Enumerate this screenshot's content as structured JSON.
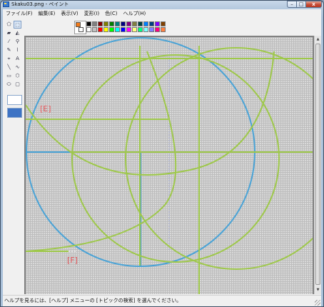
{
  "window": {
    "title": "Skaku03.png - ペイント",
    "minimize_label": "–",
    "maximize_label": "□",
    "close_label": "x"
  },
  "menu": {
    "items": [
      {
        "label": "ファイル(F)"
      },
      {
        "label": "編集(E)"
      },
      {
        "label": "表示(V)"
      },
      {
        "label": "変形(I)"
      },
      {
        "label": "色(C)"
      },
      {
        "label": "ヘルプ(H)"
      }
    ]
  },
  "toolbox": {
    "tools": [
      {
        "name": "free-form-select-icon",
        "glyph": "⬠"
      },
      {
        "name": "rect-select-icon",
        "glyph": "⬚",
        "selected": true
      },
      {
        "name": "eraser-icon",
        "glyph": "▰"
      },
      {
        "name": "fill-bucket-icon",
        "glyph": "◭"
      },
      {
        "name": "color-picker-icon",
        "glyph": "⁄"
      },
      {
        "name": "magnifier-icon",
        "glyph": "⚲"
      },
      {
        "name": "pencil-icon",
        "glyph": "✎"
      },
      {
        "name": "brush-icon",
        "glyph": "⌇"
      },
      {
        "name": "airbrush-icon",
        "glyph": "⌖"
      },
      {
        "name": "text-icon",
        "glyph": "A"
      },
      {
        "name": "line-icon",
        "glyph": "╲"
      },
      {
        "name": "curve-icon",
        "glyph": "∿"
      },
      {
        "name": "rectangle-icon",
        "glyph": "▭"
      },
      {
        "name": "polygon-icon",
        "glyph": "⬡"
      },
      {
        "name": "ellipse-icon",
        "glyph": "⬭"
      },
      {
        "name": "rounded-rectangle-icon",
        "glyph": "▢"
      }
    ]
  },
  "palette": {
    "foreground": "#f27a19",
    "background": "#ffffff",
    "colors": [
      "#000000",
      "#808080",
      "#800000",
      "#808000",
      "#008000",
      "#008080",
      "#000080",
      "#800080",
      "#808040",
      "#004040",
      "#0080ff",
      "#004080",
      "#8000ff",
      "#804000",
      "#ffffff",
      "#c0c0c0",
      "#ff0000",
      "#ffff00",
      "#00ff00",
      "#00ffff",
      "#0000ff",
      "#ff00ff",
      "#ffff80",
      "#00ff80",
      "#80ffff",
      "#8080ff",
      "#ff0080",
      "#ff8040"
    ]
  },
  "drawing": {
    "colors": {
      "blue": "#4aa3d6",
      "green": "#9ec84a",
      "label": "#e4565a"
    },
    "label_e": "[E]",
    "label_f": "[F]"
  },
  "statusbar": {
    "text": "ヘルプを見るには、[ヘルプ] メニューの [トピックの検索] を選んでください。"
  }
}
